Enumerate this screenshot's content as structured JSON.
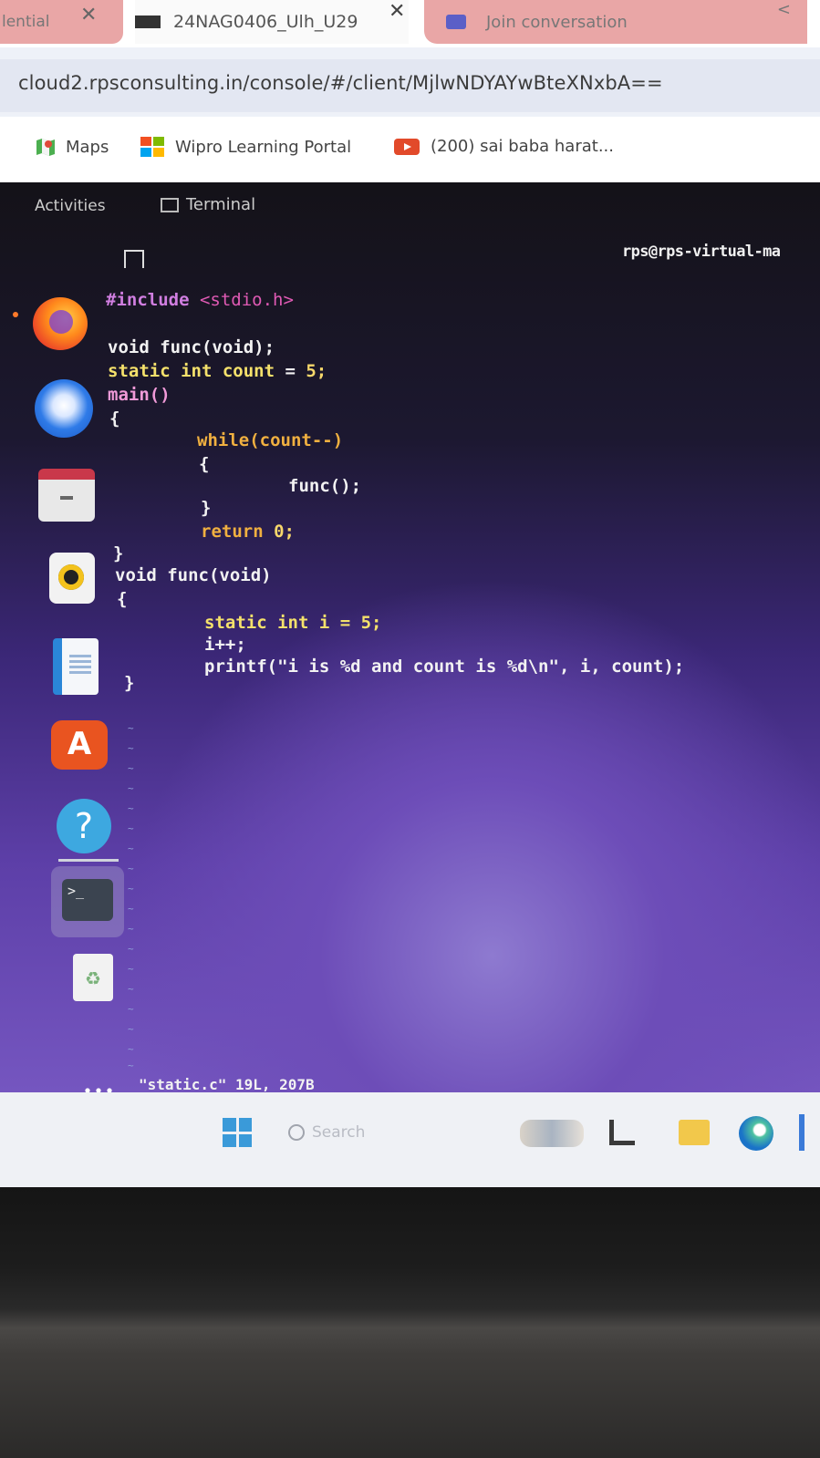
{
  "browser": {
    "tabs": [
      {
        "label": "lential",
        "close": "✕"
      },
      {
        "label": "24NAG0406_Ulh_U29",
        "close": "✕"
      },
      {
        "label": "Join conversation",
        "controls": "<"
      }
    ],
    "url": "cloud2.rpsconsulting.in/console/#/client/MjlwNDYAYwBteXNxbA==",
    "bookmarks": [
      {
        "label": "Maps",
        "icon": "maps-icon"
      },
      {
        "label": "Wipro Learning Portal",
        "icon": "wipro-icon"
      },
      {
        "label": "(200) sai baba harat...",
        "icon": "youtube-icon"
      }
    ]
  },
  "ubuntu": {
    "activities": "Activities",
    "app_title": "Terminal",
    "prompt_title": "rps@rps-virtual-ma",
    "dock": [
      "firefox-icon",
      "thunderbird-icon",
      "files-icon",
      "rhythmbox-icon",
      "writer-icon",
      "software-icon",
      "help-icon",
      "terminal-icon",
      "trash-icon",
      "apps-grid-icon"
    ],
    "help_glyph": "?",
    "software_glyph": "A",
    "terminal_glyph": ">_",
    "trash_glyph": "♻"
  },
  "editor": {
    "line_include_kw": "#include",
    "line_include_hdr": "<stdio.h>",
    "line_proto": "void func(void);",
    "line_static_kw": "static int count",
    "line_static_eq": " = ",
    "line_static_val": "5;",
    "line_main": "main()",
    "line_open1": "{",
    "line_while": "while(count--)",
    "line_open2": "{",
    "line_call": "func();",
    "line_close2": "}",
    "line_return_kw": "return ",
    "line_return_val": "0;",
    "line_close1": "}",
    "line_func_def": "void func(void)",
    "line_open3": "{",
    "line_static_i": "static int i = 5;",
    "line_inc": "i++;",
    "line_printf_a": "printf(",
    "line_printf_fmt": "\"i is %d and count is %d\\n\"",
    "line_printf_b": ", i, count);",
    "line_close3": "}",
    "tilde": "~",
    "status": "\"static.c\" 19L, 207B"
  },
  "taskbar": {
    "search_placeholder": "Search"
  }
}
